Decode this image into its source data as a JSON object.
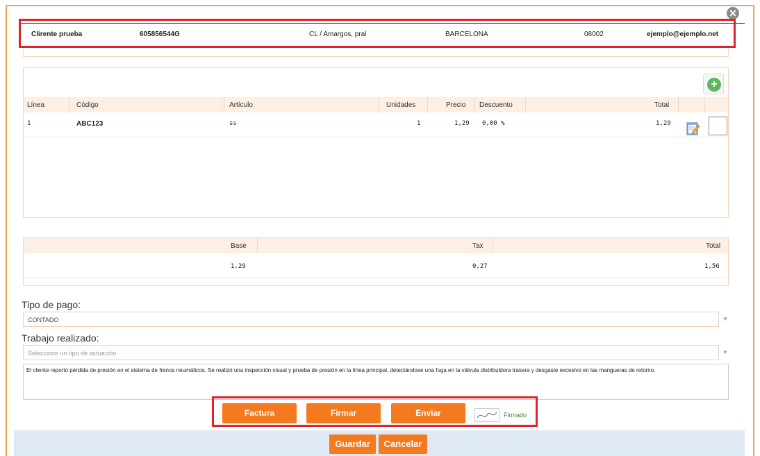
{
  "dialog": {
    "close_icon": "close-circle-icon"
  },
  "client": {
    "name": "Clirente prueba",
    "nif": "605856544G",
    "address": "CL / Amargos,    pral",
    "city": "BARCELONA",
    "zip": "08002",
    "email": "ejemplo@ejemplo.net"
  },
  "lines": {
    "add_icon": "add-circle-icon",
    "headers": {
      "linea": "Línea",
      "codigo": "Código",
      "articulo": "Artículo",
      "unidades": "Unidades",
      "precio": "Precio",
      "descuento": "Descuento",
      "total": "Total"
    },
    "rows": [
      {
        "linea": "1",
        "codigo": "ABC123",
        "articulo": "ss",
        "unidades": "1",
        "precio": "1,29",
        "descuento": "0,00 %",
        "total": "1,29",
        "edit_icon": "edit-note-icon",
        "checked": false
      }
    ]
  },
  "totals": {
    "headers": {
      "base": "Base",
      "tax": "Tax",
      "total": "Total"
    },
    "values": {
      "base": "1,29",
      "tax": "0,27",
      "total": "1,56"
    }
  },
  "payment": {
    "label": "Tipo de pago:",
    "value": "CONTADO"
  },
  "work": {
    "label": "Trabajo realizado:",
    "placeholder": "Seleccione un tipo de actuación",
    "description": "El cliente reportó pérdida de presión en el sistema de frenos neumáticos. Se realizó una inspección visual y prueba de presión en la línea principal, detectándose una fuga en la válvula distribuidora trasera y desgaste excesivo en las mangueras de retorno."
  },
  "actions": {
    "factura": "Factura",
    "firmar": "Firmar",
    "enviar": "Enviar",
    "signed_label": "Firmado",
    "signature_icon": "signature-icon"
  },
  "footer": {
    "guardar": "Guardar",
    "cancelar": "Cancelar"
  },
  "colors": {
    "accent": "#f47a1f",
    "highlight": "#e0242b",
    "header_bg": "#fdefe3",
    "footer_bg": "#dfe9f3",
    "signed": "#2a8f2a"
  }
}
